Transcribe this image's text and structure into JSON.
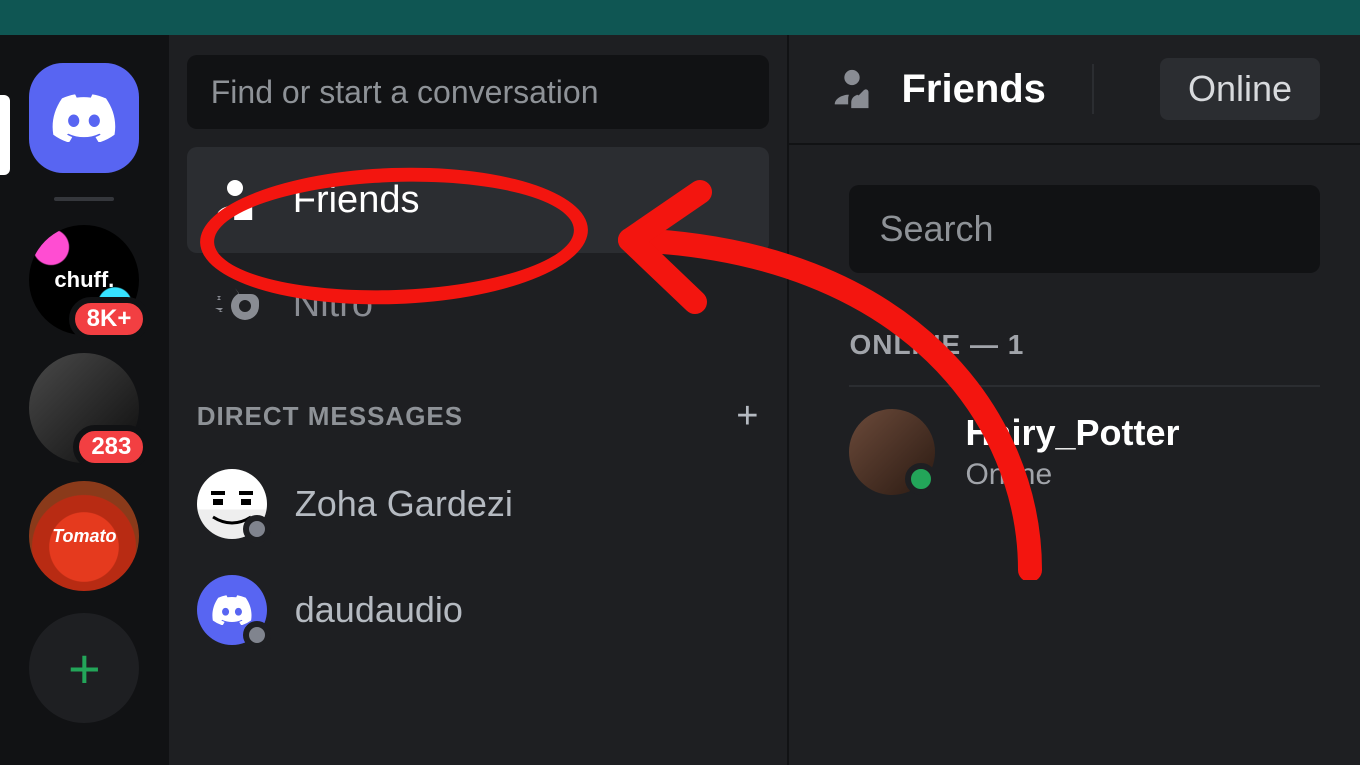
{
  "topbar": {},
  "servers": {
    "home_label": "Home",
    "chuff": {
      "label": "chuff.",
      "badge": "8K+"
    },
    "bw": {
      "badge": "283"
    },
    "tomato": {
      "label": "Tomato"
    }
  },
  "dm": {
    "search_placeholder": "Find or start a conversation",
    "friends_label": "Friends",
    "nitro_label": "Nitro",
    "dm_header": "DIRECT MESSAGES",
    "items": [
      {
        "name": "Zoha Gardezi"
      },
      {
        "name": "daudaudio"
      }
    ]
  },
  "content": {
    "header_title": "Friends",
    "tab_online": "Online",
    "search_placeholder": "Search",
    "section_label": "ONLINE — 1",
    "friends": [
      {
        "name": "Hairy_Potter",
        "status": "Online"
      }
    ]
  }
}
